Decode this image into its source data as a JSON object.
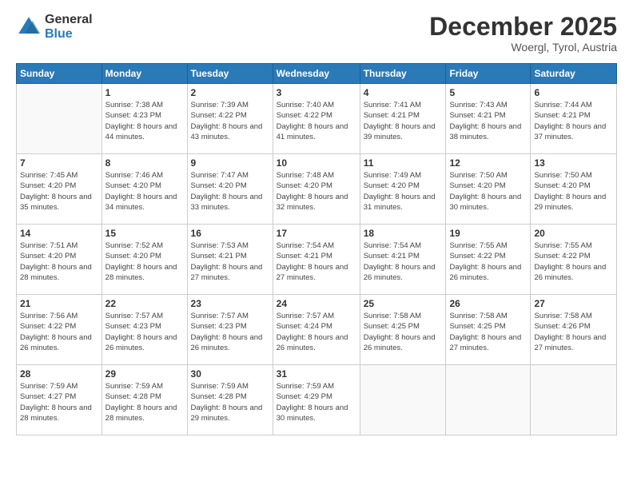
{
  "logo": {
    "general": "General",
    "blue": "Blue"
  },
  "header": {
    "month": "December 2025",
    "location": "Woergl, Tyrol, Austria"
  },
  "days_of_week": [
    "Sunday",
    "Monday",
    "Tuesday",
    "Wednesday",
    "Thursday",
    "Friday",
    "Saturday"
  ],
  "weeks": [
    [
      {
        "day": "",
        "sunrise": "",
        "sunset": "",
        "daylight": ""
      },
      {
        "day": "1",
        "sunrise": "Sunrise: 7:38 AM",
        "sunset": "Sunset: 4:23 PM",
        "daylight": "Daylight: 8 hours and 44 minutes."
      },
      {
        "day": "2",
        "sunrise": "Sunrise: 7:39 AM",
        "sunset": "Sunset: 4:22 PM",
        "daylight": "Daylight: 8 hours and 43 minutes."
      },
      {
        "day": "3",
        "sunrise": "Sunrise: 7:40 AM",
        "sunset": "Sunset: 4:22 PM",
        "daylight": "Daylight: 8 hours and 41 minutes."
      },
      {
        "day": "4",
        "sunrise": "Sunrise: 7:41 AM",
        "sunset": "Sunset: 4:21 PM",
        "daylight": "Daylight: 8 hours and 39 minutes."
      },
      {
        "day": "5",
        "sunrise": "Sunrise: 7:43 AM",
        "sunset": "Sunset: 4:21 PM",
        "daylight": "Daylight: 8 hours and 38 minutes."
      },
      {
        "day": "6",
        "sunrise": "Sunrise: 7:44 AM",
        "sunset": "Sunset: 4:21 PM",
        "daylight": "Daylight: 8 hours and 37 minutes."
      }
    ],
    [
      {
        "day": "7",
        "sunrise": "Sunrise: 7:45 AM",
        "sunset": "Sunset: 4:20 PM",
        "daylight": "Daylight: 8 hours and 35 minutes."
      },
      {
        "day": "8",
        "sunrise": "Sunrise: 7:46 AM",
        "sunset": "Sunset: 4:20 PM",
        "daylight": "Daylight: 8 hours and 34 minutes."
      },
      {
        "day": "9",
        "sunrise": "Sunrise: 7:47 AM",
        "sunset": "Sunset: 4:20 PM",
        "daylight": "Daylight: 8 hours and 33 minutes."
      },
      {
        "day": "10",
        "sunrise": "Sunrise: 7:48 AM",
        "sunset": "Sunset: 4:20 PM",
        "daylight": "Daylight: 8 hours and 32 minutes."
      },
      {
        "day": "11",
        "sunrise": "Sunrise: 7:49 AM",
        "sunset": "Sunset: 4:20 PM",
        "daylight": "Daylight: 8 hours and 31 minutes."
      },
      {
        "day": "12",
        "sunrise": "Sunrise: 7:50 AM",
        "sunset": "Sunset: 4:20 PM",
        "daylight": "Daylight: 8 hours and 30 minutes."
      },
      {
        "day": "13",
        "sunrise": "Sunrise: 7:50 AM",
        "sunset": "Sunset: 4:20 PM",
        "daylight": "Daylight: 8 hours and 29 minutes."
      }
    ],
    [
      {
        "day": "14",
        "sunrise": "Sunrise: 7:51 AM",
        "sunset": "Sunset: 4:20 PM",
        "daylight": "Daylight: 8 hours and 28 minutes."
      },
      {
        "day": "15",
        "sunrise": "Sunrise: 7:52 AM",
        "sunset": "Sunset: 4:20 PM",
        "daylight": "Daylight: 8 hours and 28 minutes."
      },
      {
        "day": "16",
        "sunrise": "Sunrise: 7:53 AM",
        "sunset": "Sunset: 4:21 PM",
        "daylight": "Daylight: 8 hours and 27 minutes."
      },
      {
        "day": "17",
        "sunrise": "Sunrise: 7:54 AM",
        "sunset": "Sunset: 4:21 PM",
        "daylight": "Daylight: 8 hours and 27 minutes."
      },
      {
        "day": "18",
        "sunrise": "Sunrise: 7:54 AM",
        "sunset": "Sunset: 4:21 PM",
        "daylight": "Daylight: 8 hours and 26 minutes."
      },
      {
        "day": "19",
        "sunrise": "Sunrise: 7:55 AM",
        "sunset": "Sunset: 4:22 PM",
        "daylight": "Daylight: 8 hours and 26 minutes."
      },
      {
        "day": "20",
        "sunrise": "Sunrise: 7:55 AM",
        "sunset": "Sunset: 4:22 PM",
        "daylight": "Daylight: 8 hours and 26 minutes."
      }
    ],
    [
      {
        "day": "21",
        "sunrise": "Sunrise: 7:56 AM",
        "sunset": "Sunset: 4:22 PM",
        "daylight": "Daylight: 8 hours and 26 minutes."
      },
      {
        "day": "22",
        "sunrise": "Sunrise: 7:57 AM",
        "sunset": "Sunset: 4:23 PM",
        "daylight": "Daylight: 8 hours and 26 minutes."
      },
      {
        "day": "23",
        "sunrise": "Sunrise: 7:57 AM",
        "sunset": "Sunset: 4:23 PM",
        "daylight": "Daylight: 8 hours and 26 minutes."
      },
      {
        "day": "24",
        "sunrise": "Sunrise: 7:57 AM",
        "sunset": "Sunset: 4:24 PM",
        "daylight": "Daylight: 8 hours and 26 minutes."
      },
      {
        "day": "25",
        "sunrise": "Sunrise: 7:58 AM",
        "sunset": "Sunset: 4:25 PM",
        "daylight": "Daylight: 8 hours and 26 minutes."
      },
      {
        "day": "26",
        "sunrise": "Sunrise: 7:58 AM",
        "sunset": "Sunset: 4:25 PM",
        "daylight": "Daylight: 8 hours and 27 minutes."
      },
      {
        "day": "27",
        "sunrise": "Sunrise: 7:58 AM",
        "sunset": "Sunset: 4:26 PM",
        "daylight": "Daylight: 8 hours and 27 minutes."
      }
    ],
    [
      {
        "day": "28",
        "sunrise": "Sunrise: 7:59 AM",
        "sunset": "Sunset: 4:27 PM",
        "daylight": "Daylight: 8 hours and 28 minutes."
      },
      {
        "day": "29",
        "sunrise": "Sunrise: 7:59 AM",
        "sunset": "Sunset: 4:28 PM",
        "daylight": "Daylight: 8 hours and 28 minutes."
      },
      {
        "day": "30",
        "sunrise": "Sunrise: 7:59 AM",
        "sunset": "Sunset: 4:28 PM",
        "daylight": "Daylight: 8 hours and 29 minutes."
      },
      {
        "day": "31",
        "sunrise": "Sunrise: 7:59 AM",
        "sunset": "Sunset: 4:29 PM",
        "daylight": "Daylight: 8 hours and 30 minutes."
      },
      {
        "day": "",
        "sunrise": "",
        "sunset": "",
        "daylight": ""
      },
      {
        "day": "",
        "sunrise": "",
        "sunset": "",
        "daylight": ""
      },
      {
        "day": "",
        "sunrise": "",
        "sunset": "",
        "daylight": ""
      }
    ]
  ]
}
